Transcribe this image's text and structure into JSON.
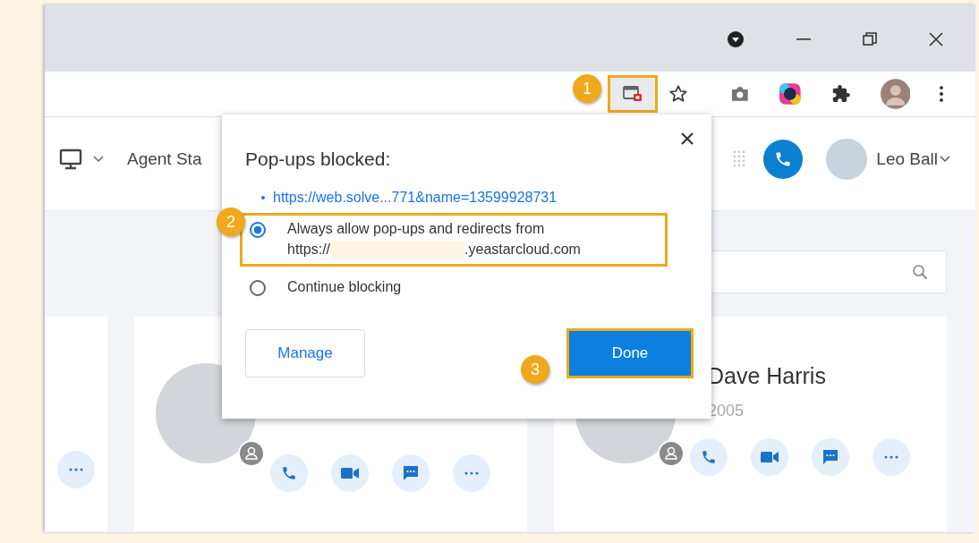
{
  "callouts": [
    {
      "number": "1"
    },
    {
      "number": "2"
    },
    {
      "number": "3"
    }
  ],
  "app_header": {
    "nav_label": "Agent Sta",
    "user_name": "Leo Ball"
  },
  "contact_cards": [
    {
      "name": "Dave Harris",
      "extension": "2005"
    }
  ],
  "popup": {
    "title": "Pop-ups blocked:",
    "link": "https://web.solve...771&name=13599928731",
    "options": [
      {
        "label": "Always allow pop-ups and redirects from",
        "url_start": "https://",
        "url_end": ".yeastarcloud.com",
        "selected": true
      },
      {
        "label": "Continue blocking",
        "selected": false
      }
    ],
    "buttons": [
      "Manage",
      "Done"
    ]
  }
}
